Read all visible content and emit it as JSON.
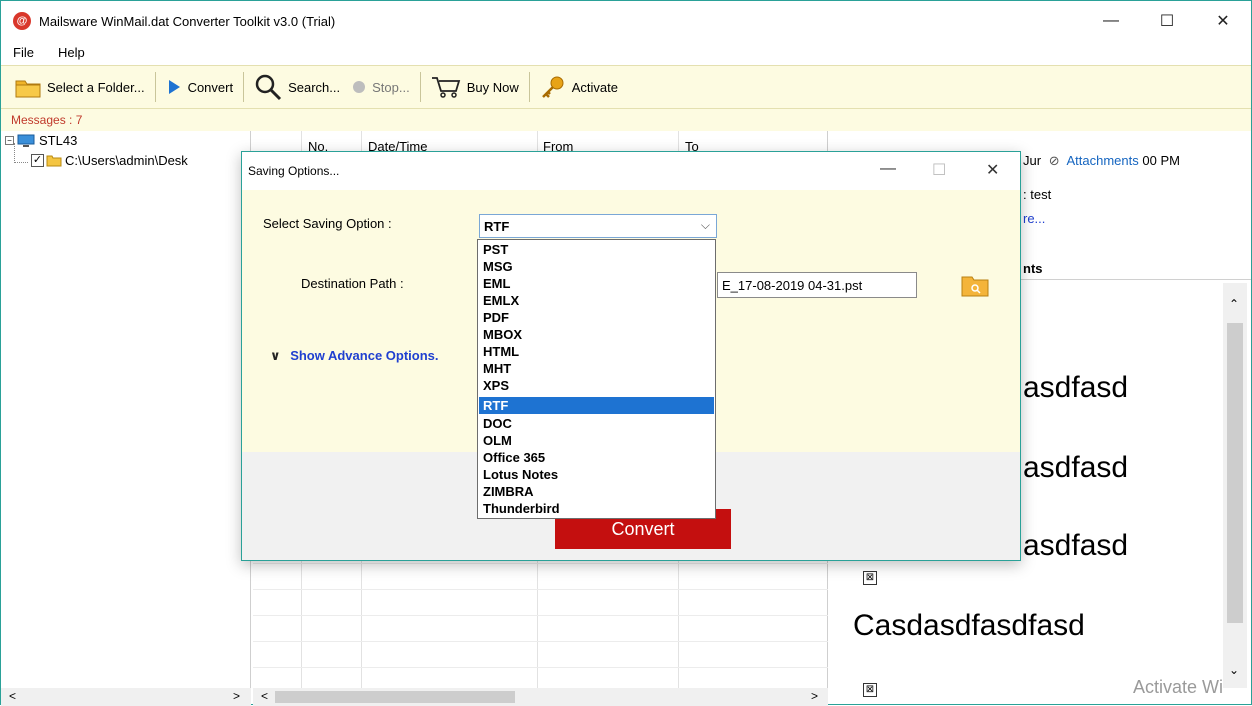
{
  "app": {
    "title": "Mailsware WinMail.dat Converter Toolkit v3.0 (Trial)",
    "logo_icon": "mailsware-logo-icon"
  },
  "window_controls": {
    "minimize": "—",
    "maximize": "☐",
    "close": "✕"
  },
  "menu": [
    {
      "label": "File"
    },
    {
      "label": "Help"
    }
  ],
  "toolbar": {
    "select_folder": "Select a Folder...",
    "convert": "Convert",
    "search": "Search...",
    "stop": "Stop...",
    "buy_now": "Buy Now",
    "activate": "Activate"
  },
  "status": {
    "messages": "Messages : 7"
  },
  "tree": {
    "root": "STL43",
    "child": "C:\\Users\\admin\\Desk"
  },
  "grid": {
    "columns": [
      "No.",
      "Date/Time",
      "From",
      "To"
    ]
  },
  "preview": {
    "header_fragment": "Jur",
    "attachments_label": "Attachments",
    "time_fragment": "00 PM",
    "subject_fragment": ": test",
    "more_fragment": "re...",
    "tab_fragment": "nts",
    "body_lines": [
      "asdfasd",
      "asdfasd",
      "asdfasd",
      "Casdasdfasdfasd"
    ],
    "watermark": "Activate Wi"
  },
  "dialog": {
    "title": "Saving Options...",
    "select_label": "Select Saving Option :",
    "selected_value": "RTF",
    "destination_label": "Destination Path :",
    "destination_value": "E_17-08-2019 04-31.pst",
    "advance_options": "Show Advance Options.",
    "convert_button": "Convert",
    "options": [
      "PST",
      "MSG",
      "EML",
      "EMLX",
      "PDF",
      "MBOX",
      "HTML",
      "MHT",
      "XPS",
      "RTF",
      "DOC",
      "OLM",
      "Office 365",
      "Lotus Notes",
      "ZIMBRA",
      "Thunderbird"
    ]
  },
  "colors": {
    "accent_border": "#2aa198",
    "toolbar_bg": "#fdfbe1",
    "convert_red": "#c40f0f",
    "selection_blue": "#1e73d2",
    "link_blue": "#1f3fd0"
  }
}
